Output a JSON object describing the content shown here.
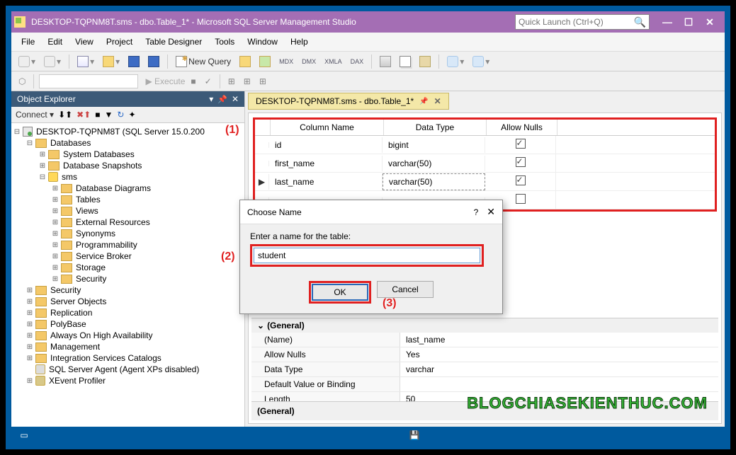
{
  "title": "DESKTOP-TQPNM8T.sms - dbo.Table_1* - Microsoft SQL Server Management Studio",
  "quick_launch": {
    "placeholder": "Quick Launch (Ctrl+Q)"
  },
  "menu": [
    "File",
    "Edit",
    "View",
    "Project",
    "Table Designer",
    "Tools",
    "Window",
    "Help"
  ],
  "toolbar": {
    "new_query": "New Query",
    "execute": "Execute"
  },
  "object_explorer": {
    "title": "Object Explorer",
    "connect": "Connect",
    "server": "DESKTOP-TQPNM8T (SQL Server 15.0.200",
    "nodes": {
      "databases": "Databases",
      "sys_db": "System Databases",
      "snapshots": "Database Snapshots",
      "sms": "sms",
      "diagrams": "Database Diagrams",
      "tables": "Tables",
      "views": "Views",
      "ext_res": "External Resources",
      "synonyms": "Synonyms",
      "programmability": "Programmability",
      "service_broker": "Service Broker",
      "storage": "Storage",
      "security": "Security",
      "srv_security": "Security",
      "server_objects": "Server Objects",
      "replication": "Replication",
      "polybase": "PolyBase",
      "always_on": "Always On High Availability",
      "management": "Management",
      "isc": "Integration Services Catalogs",
      "agent": "SQL Server Agent (Agent XPs disabled)",
      "xevent": "XEvent Profiler"
    }
  },
  "tab": {
    "label": "DESKTOP-TQPNM8T.sms - dbo.Table_1*"
  },
  "grid": {
    "headers": {
      "name": "Column Name",
      "type": "Data Type",
      "null": "Allow Nulls"
    },
    "rows": [
      {
        "name": "id",
        "type": "bigint",
        "null": true,
        "editing": false,
        "indicator": ""
      },
      {
        "name": "first_name",
        "type": "varchar(50)",
        "null": true,
        "editing": false,
        "indicator": ""
      },
      {
        "name": "last_name",
        "type": "varchar(50)",
        "null": true,
        "editing": true,
        "indicator": "▶"
      }
    ]
  },
  "props": {
    "section": "(General)",
    "rows": [
      {
        "k": "(Name)",
        "v": "last_name"
      },
      {
        "k": "Allow Nulls",
        "v": "Yes"
      },
      {
        "k": "Data Type",
        "v": "varchar"
      },
      {
        "k": "Default Value or Binding",
        "v": ""
      },
      {
        "k": "Length",
        "v": "50"
      }
    ],
    "footer": "(General)"
  },
  "dialog": {
    "title": "Choose Name",
    "label": "Enter a name for the table:",
    "value": "student",
    "ok": "OK",
    "cancel": "Cancel"
  },
  "annotations": {
    "a1": "(1)",
    "a2": "(2)",
    "a3": "(3)"
  },
  "watermark": "BLOGCHIASEKIENTHUC.COM"
}
